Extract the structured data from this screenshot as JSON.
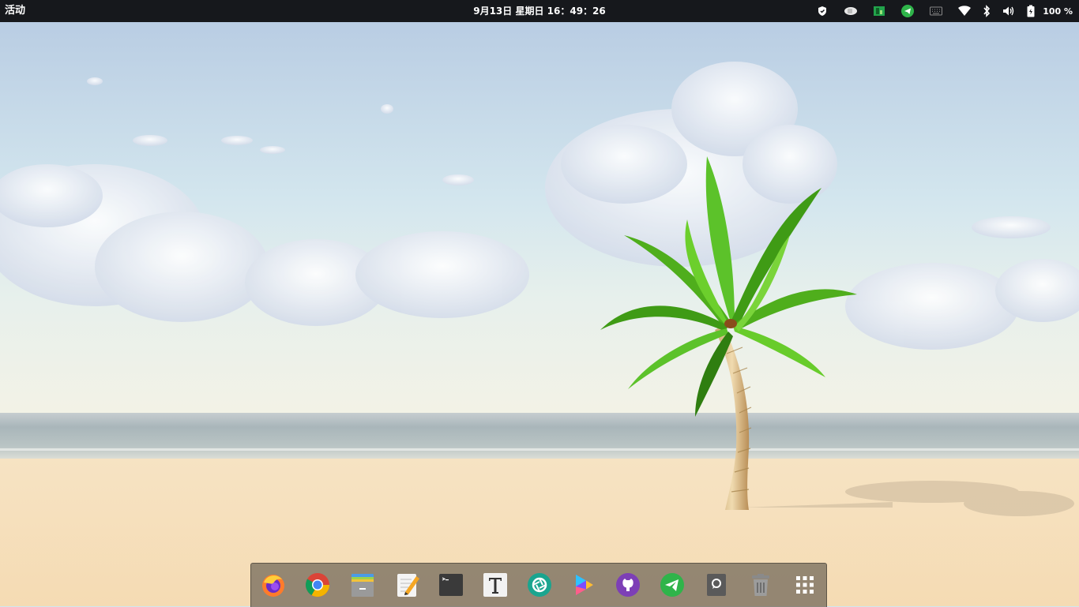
{
  "topbar": {
    "activities_label": "活动",
    "clock": "9月13日 星期日 16：49：26",
    "tray_icons": [
      "shield-icon",
      "cup-icon",
      "app-indicator-icon",
      "telegram-tray-icon",
      "keyboard-icon",
      "wifi-icon",
      "bluetooth-icon",
      "volume-icon",
      "battery-icon"
    ],
    "battery_percent": "100 %"
  },
  "dock": {
    "items": [
      {
        "name": "firefox",
        "icon": "firefox-icon"
      },
      {
        "name": "chrome",
        "icon": "chrome-icon"
      },
      {
        "name": "files",
        "icon": "file-manager-icon"
      },
      {
        "name": "text-editor",
        "icon": "text-editor-icon"
      },
      {
        "name": "terminal",
        "icon": "terminal-icon"
      },
      {
        "name": "typora",
        "icon": "typora-icon"
      },
      {
        "name": "screenshot",
        "icon": "camera-shutter-icon"
      },
      {
        "name": "media-player",
        "icon": "play-icon"
      },
      {
        "name": "github",
        "icon": "github-icon"
      },
      {
        "name": "telegram",
        "icon": "telegram-icon"
      },
      {
        "name": "notes",
        "icon": "notes-icon"
      },
      {
        "name": "trash",
        "icon": "trash-icon"
      },
      {
        "name": "show-apps",
        "icon": "app-grid-icon"
      }
    ]
  },
  "colors": {
    "topbar_bg": "#16181c",
    "sky_top": "#b9cfe4",
    "sand": "#f4dcb6",
    "sea": "#aab8bd",
    "palm_green": "#4fae1c"
  }
}
